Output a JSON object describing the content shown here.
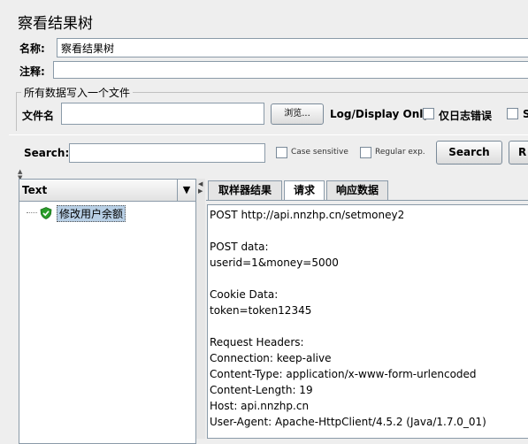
{
  "window": {
    "title": "察看结果树"
  },
  "form": {
    "name_label": "名称:",
    "name_value": "察看结果树",
    "comment_label": "注释:",
    "comment_value": ""
  },
  "file_section": {
    "heading": "所有数据写入一个文件",
    "filename_label": "文件名",
    "filename_value": "",
    "browse_label": "浏览...",
    "log_display_label": "Log/Display Only:",
    "errors_only_label": "仅日志错误",
    "next_option_label": "S"
  },
  "search": {
    "label": "Search:",
    "value": "",
    "case_sensitive_label": "Case sensitive",
    "regex_label": "Regular exp.",
    "search_button": "Search",
    "reset_button": "R"
  },
  "tree": {
    "renderer": "Text",
    "items": [
      {
        "label": "修改用户余额",
        "status": "success"
      }
    ]
  },
  "tabs": [
    {
      "label": "取样器结果",
      "selected": false
    },
    {
      "label": "请求",
      "selected": true
    },
    {
      "label": "响应数据",
      "selected": false
    }
  ],
  "request_lines": [
    "POST http://api.nnzhp.cn/setmoney2",
    "",
    "POST data:",
    "userid=1&money=5000",
    "",
    "Cookie Data:",
    "token=token12345",
    "",
    "Request Headers:",
    "Connection: keep-alive",
    "Content-Type: application/x-www-form-urlencoded",
    "Content-Length: 19",
    "Host: api.nnzhp.cn",
    "User-Agent: Apache-HttpClient/4.5.2 (Java/1.7.0_01)"
  ],
  "colors": {
    "success": "#2a9d2a",
    "selection": "#b8cfe5"
  }
}
